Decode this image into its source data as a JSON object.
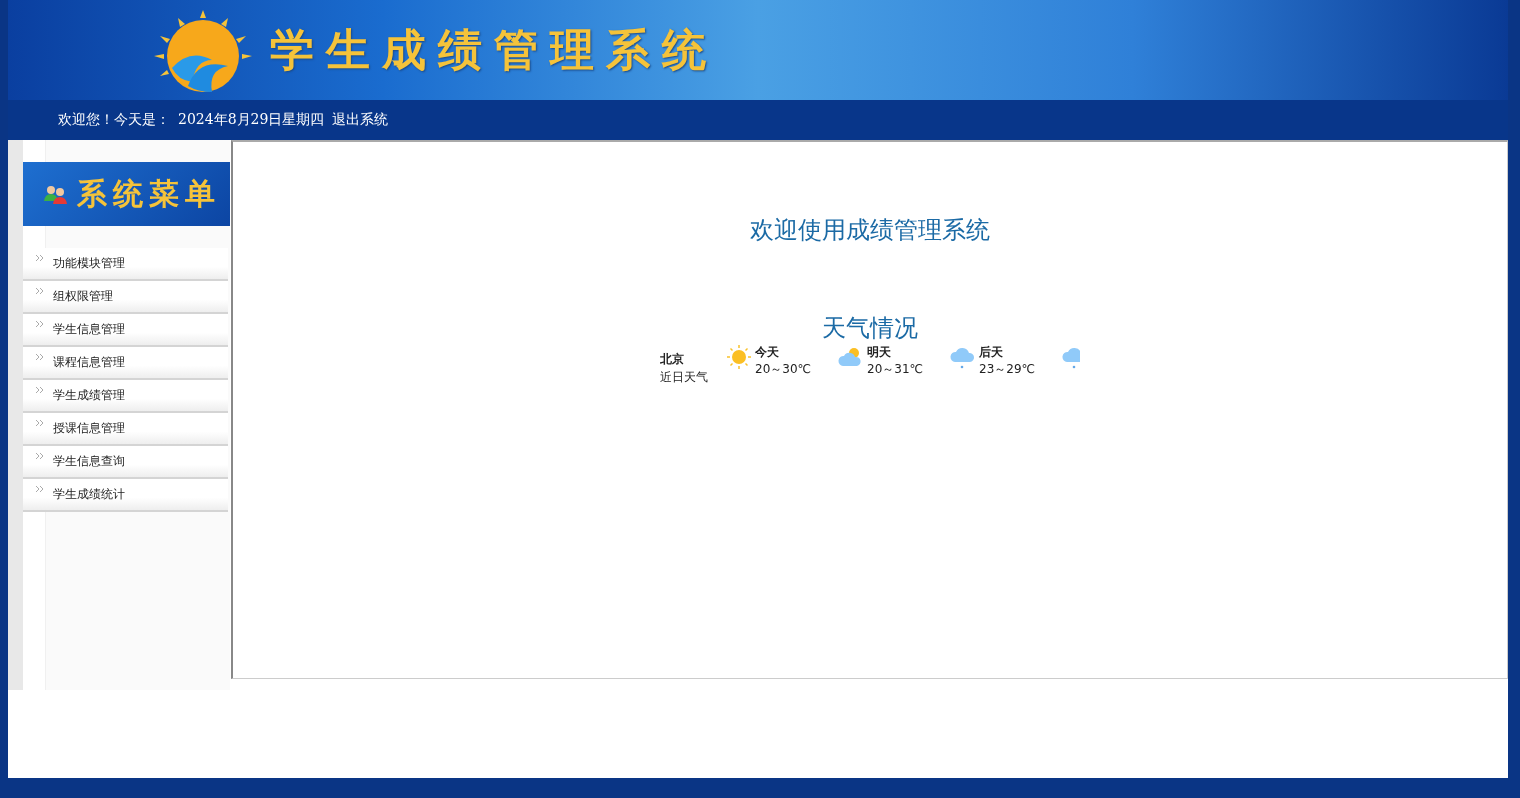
{
  "header": {
    "title": "学生成绩管理系统"
  },
  "info_bar": {
    "greeting": "欢迎您！今天是：",
    "date": "2024年8月29日星期四",
    "logout": "退出系统"
  },
  "sidebar": {
    "title": "系统菜单",
    "items": [
      {
        "label": "功能模块管理"
      },
      {
        "label": "组权限管理"
      },
      {
        "label": "学生信息管理"
      },
      {
        "label": "课程信息管理"
      },
      {
        "label": "学生成绩管理"
      },
      {
        "label": "授课信息管理"
      },
      {
        "label": "学生信息查询"
      },
      {
        "label": "学生成绩统计"
      }
    ]
  },
  "main": {
    "welcome": "欢迎使用成绩管理系统",
    "weather_title": "天气情况",
    "weather": {
      "city": "北京",
      "subtitle": "近日天气",
      "forecast": [
        {
          "kind": "sunny",
          "day": "今天",
          "range": "20～30℃"
        },
        {
          "kind": "partly-cloudy",
          "day": "明天",
          "range": "20～31℃"
        },
        {
          "kind": "rain",
          "day": "后天",
          "range": "23～29℃"
        },
        {
          "kind": "rain"
        }
      ]
    }
  }
}
